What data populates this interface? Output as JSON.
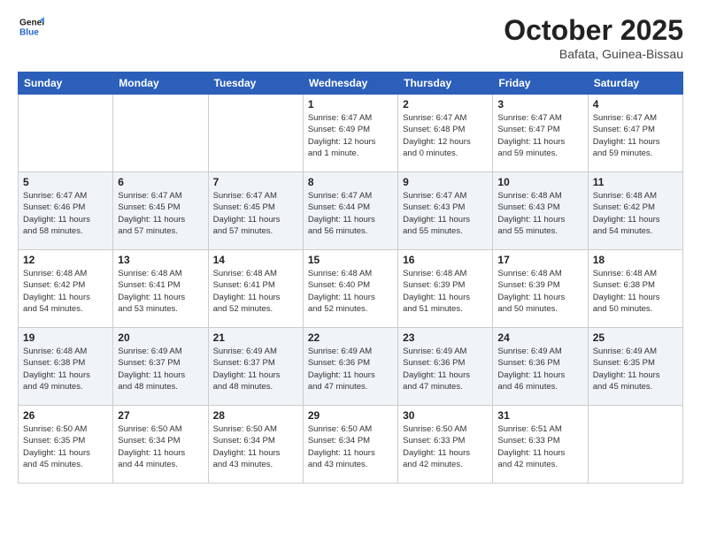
{
  "header": {
    "logo_line1": "General",
    "logo_line2": "Blue",
    "month_title": "October 2025",
    "location": "Bafata, Guinea-Bissau"
  },
  "days_of_week": [
    "Sunday",
    "Monday",
    "Tuesday",
    "Wednesday",
    "Thursday",
    "Friday",
    "Saturday"
  ],
  "weeks": [
    [
      {
        "day": "",
        "info": ""
      },
      {
        "day": "",
        "info": ""
      },
      {
        "day": "",
        "info": ""
      },
      {
        "day": "1",
        "info": "Sunrise: 6:47 AM\nSunset: 6:49 PM\nDaylight: 12 hours\nand 1 minute."
      },
      {
        "day": "2",
        "info": "Sunrise: 6:47 AM\nSunset: 6:48 PM\nDaylight: 12 hours\nand 0 minutes."
      },
      {
        "day": "3",
        "info": "Sunrise: 6:47 AM\nSunset: 6:47 PM\nDaylight: 11 hours\nand 59 minutes."
      },
      {
        "day": "4",
        "info": "Sunrise: 6:47 AM\nSunset: 6:47 PM\nDaylight: 11 hours\nand 59 minutes."
      }
    ],
    [
      {
        "day": "5",
        "info": "Sunrise: 6:47 AM\nSunset: 6:46 PM\nDaylight: 11 hours\nand 58 minutes."
      },
      {
        "day": "6",
        "info": "Sunrise: 6:47 AM\nSunset: 6:45 PM\nDaylight: 11 hours\nand 57 minutes."
      },
      {
        "day": "7",
        "info": "Sunrise: 6:47 AM\nSunset: 6:45 PM\nDaylight: 11 hours\nand 57 minutes."
      },
      {
        "day": "8",
        "info": "Sunrise: 6:47 AM\nSunset: 6:44 PM\nDaylight: 11 hours\nand 56 minutes."
      },
      {
        "day": "9",
        "info": "Sunrise: 6:47 AM\nSunset: 6:43 PM\nDaylight: 11 hours\nand 55 minutes."
      },
      {
        "day": "10",
        "info": "Sunrise: 6:48 AM\nSunset: 6:43 PM\nDaylight: 11 hours\nand 55 minutes."
      },
      {
        "day": "11",
        "info": "Sunrise: 6:48 AM\nSunset: 6:42 PM\nDaylight: 11 hours\nand 54 minutes."
      }
    ],
    [
      {
        "day": "12",
        "info": "Sunrise: 6:48 AM\nSunset: 6:42 PM\nDaylight: 11 hours\nand 54 minutes."
      },
      {
        "day": "13",
        "info": "Sunrise: 6:48 AM\nSunset: 6:41 PM\nDaylight: 11 hours\nand 53 minutes."
      },
      {
        "day": "14",
        "info": "Sunrise: 6:48 AM\nSunset: 6:41 PM\nDaylight: 11 hours\nand 52 minutes."
      },
      {
        "day": "15",
        "info": "Sunrise: 6:48 AM\nSunset: 6:40 PM\nDaylight: 11 hours\nand 52 minutes."
      },
      {
        "day": "16",
        "info": "Sunrise: 6:48 AM\nSunset: 6:39 PM\nDaylight: 11 hours\nand 51 minutes."
      },
      {
        "day": "17",
        "info": "Sunrise: 6:48 AM\nSunset: 6:39 PM\nDaylight: 11 hours\nand 50 minutes."
      },
      {
        "day": "18",
        "info": "Sunrise: 6:48 AM\nSunset: 6:38 PM\nDaylight: 11 hours\nand 50 minutes."
      }
    ],
    [
      {
        "day": "19",
        "info": "Sunrise: 6:48 AM\nSunset: 6:38 PM\nDaylight: 11 hours\nand 49 minutes."
      },
      {
        "day": "20",
        "info": "Sunrise: 6:49 AM\nSunset: 6:37 PM\nDaylight: 11 hours\nand 48 minutes."
      },
      {
        "day": "21",
        "info": "Sunrise: 6:49 AM\nSunset: 6:37 PM\nDaylight: 11 hours\nand 48 minutes."
      },
      {
        "day": "22",
        "info": "Sunrise: 6:49 AM\nSunset: 6:36 PM\nDaylight: 11 hours\nand 47 minutes."
      },
      {
        "day": "23",
        "info": "Sunrise: 6:49 AM\nSunset: 6:36 PM\nDaylight: 11 hours\nand 47 minutes."
      },
      {
        "day": "24",
        "info": "Sunrise: 6:49 AM\nSunset: 6:36 PM\nDaylight: 11 hours\nand 46 minutes."
      },
      {
        "day": "25",
        "info": "Sunrise: 6:49 AM\nSunset: 6:35 PM\nDaylight: 11 hours\nand 45 minutes."
      }
    ],
    [
      {
        "day": "26",
        "info": "Sunrise: 6:50 AM\nSunset: 6:35 PM\nDaylight: 11 hours\nand 45 minutes."
      },
      {
        "day": "27",
        "info": "Sunrise: 6:50 AM\nSunset: 6:34 PM\nDaylight: 11 hours\nand 44 minutes."
      },
      {
        "day": "28",
        "info": "Sunrise: 6:50 AM\nSunset: 6:34 PM\nDaylight: 11 hours\nand 43 minutes."
      },
      {
        "day": "29",
        "info": "Sunrise: 6:50 AM\nSunset: 6:34 PM\nDaylight: 11 hours\nand 43 minutes."
      },
      {
        "day": "30",
        "info": "Sunrise: 6:50 AM\nSunset: 6:33 PM\nDaylight: 11 hours\nand 42 minutes."
      },
      {
        "day": "31",
        "info": "Sunrise: 6:51 AM\nSunset: 6:33 PM\nDaylight: 11 hours\nand 42 minutes."
      },
      {
        "day": "",
        "info": ""
      }
    ]
  ]
}
